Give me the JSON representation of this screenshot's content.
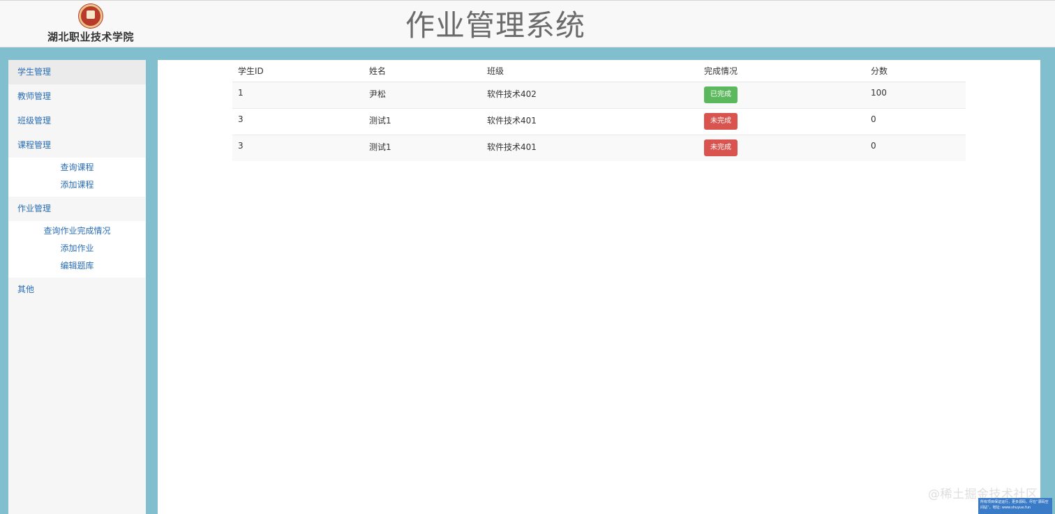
{
  "header": {
    "school_name": "湖北职业技术学院",
    "app_title": "作业管理系统"
  },
  "sidebar": {
    "items": [
      {
        "label": "学生管理"
      },
      {
        "label": "教师管理"
      },
      {
        "label": "班级管理"
      },
      {
        "label": "课程管理",
        "children": [
          "查询课程",
          "添加课程"
        ]
      },
      {
        "label": "作业管理",
        "children": [
          "查询作业完成情况",
          "添加作业",
          "编辑题库"
        ]
      },
      {
        "label": "其他"
      }
    ]
  },
  "table": {
    "columns": [
      "学生ID",
      "姓名",
      "班级",
      "完成情况",
      "分数"
    ],
    "rows": [
      {
        "id": "1",
        "name": "尹松",
        "class": "软件技术402",
        "status": "已完成",
        "status_type": "done",
        "score": "100"
      },
      {
        "id": "3",
        "name": "测试1",
        "class": "软件技术401",
        "status": "未完成",
        "status_type": "undone",
        "score": "0"
      },
      {
        "id": "3",
        "name": "测试1",
        "class": "软件技术401",
        "status": "未完成",
        "status_type": "undone",
        "score": "0"
      }
    ]
  },
  "watermark": {
    "text": "@稀土掘金技术社区",
    "note": "所有项目保证运行，更多源码，尽在“源码空间站”，地址: www.shuyue.fun"
  },
  "colors": {
    "page_bg": "#81bfcf",
    "link": "#2a6db5",
    "success": "#5cb85c",
    "danger": "#d9534f"
  }
}
